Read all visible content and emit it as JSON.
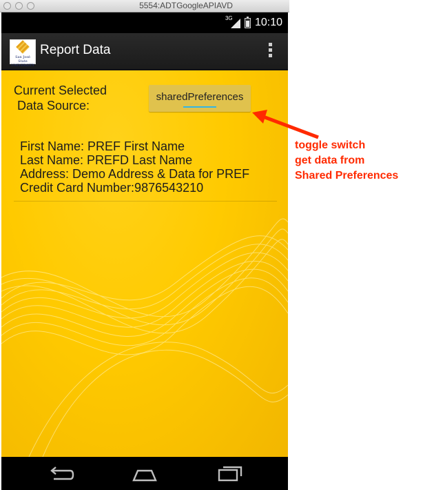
{
  "window": {
    "title": "5554:ADTGoogleAPIAVD"
  },
  "status_bar": {
    "network": "3G",
    "time": "10:10"
  },
  "action_bar": {
    "title": "Report Data",
    "logo_text": "San José State UNIVERSITY",
    "overflow_icon": "overflow-menu-icon"
  },
  "content": {
    "label_line1": "Current Selected",
    "label_line2": "Data Source:",
    "toggle_label": "sharedPreferences",
    "first_name": "First Name: PREF First Name",
    "last_name": "Last Name: PREFD Last Name",
    "address": "Address: Demo Address & Data for PREF",
    "credit_card": "Credit Card Number:9876543210"
  },
  "nav_bar": {
    "icons": [
      "back-icon",
      "home-icon",
      "recent-apps-icon"
    ]
  },
  "annotation": {
    "line1": "toggle switch",
    "line2": "get data from",
    "line3": "Shared Preferences",
    "color": "#ff2a00"
  },
  "colors": {
    "accent": "#33b5e5",
    "background": "#ffca00",
    "button": "#e0c24d"
  }
}
